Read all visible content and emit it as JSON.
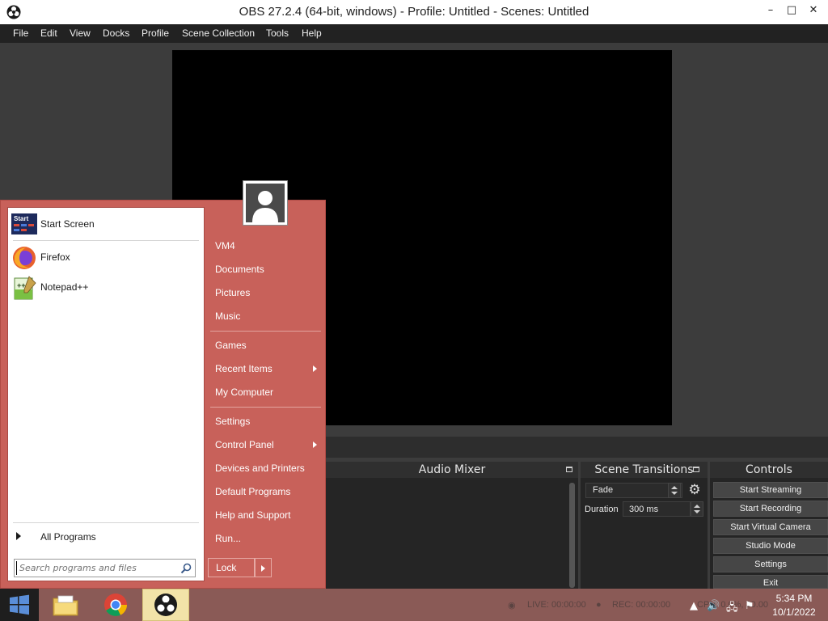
{
  "window": {
    "title": "OBS 27.2.4 (64-bit, windows) - Profile: Untitled - Scenes: Untitled",
    "minimize_glyph": "–",
    "maximize_glyph": "□",
    "close_glyph": "✕"
  },
  "menubar": [
    "File",
    "Edit",
    "View",
    "Docks",
    "Profile",
    "Scene Collection",
    "Tools",
    "Help"
  ],
  "docks": {
    "audio_mixer": "Audio Mixer",
    "scene_transitions": "Scene Transitions",
    "controls": "Controls"
  },
  "transitions": {
    "selected": "Fade",
    "duration_label": "Duration",
    "duration_value": "300 ms"
  },
  "controls": [
    "Start Streaming",
    "Start Recording",
    "Start Virtual Camera",
    "Studio Mode",
    "Settings",
    "Exit"
  ],
  "status": {
    "live": "LIVE: 00:00:00",
    "rec": "REC: 00:00:00",
    "cpu": "CPU: 0.0%, 30.00 fps"
  },
  "start_menu": {
    "pinned": [
      {
        "label": "Start Screen",
        "icon": "start-screen-icon"
      },
      {
        "label": "Firefox",
        "icon": "firefox-icon"
      },
      {
        "label": "Notepad++",
        "icon": "notepadpp-icon"
      }
    ],
    "all_programs": "All Programs",
    "search_placeholder": "Search programs and files",
    "right_items": {
      "vm4": "VM4",
      "documents": "Documents",
      "pictures": "Pictures",
      "music": "Music",
      "games": "Games",
      "recent_items": "Recent Items",
      "my_computer": "My Computer",
      "settings": "Settings",
      "control_panel": "Control Panel",
      "devices_printers": "Devices and Printers",
      "default_programs": "Default Programs",
      "help_support": "Help and Support",
      "run": "Run..."
    },
    "lock": "Lock"
  },
  "taskbar": {
    "apps": [
      "file-explorer-icon",
      "chrome-icon",
      "obs-icon"
    ],
    "time": "5:34 PM",
    "date": "10/1/2022"
  },
  "colors": {
    "start_menu_bg": "#c8615a",
    "taskbar_bg": "#8a5a56",
    "obs_bg": "#3c3c3c"
  }
}
